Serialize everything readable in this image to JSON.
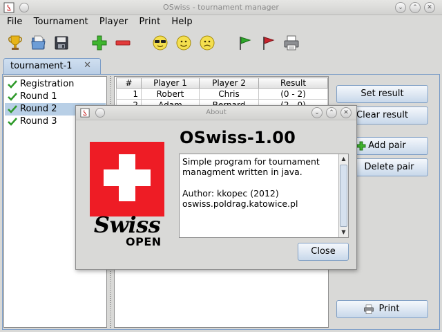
{
  "window": {
    "title": "OSwiss - tournament manager"
  },
  "menu": [
    "File",
    "Tournament",
    "Player",
    "Print",
    "Help"
  ],
  "toolbar_icons": [
    "trophy-icon",
    "open-icon",
    "save-icon",
    "add-icon",
    "remove-icon",
    "cool-smiley-icon",
    "happy-smiley-icon",
    "sad-smiley-icon",
    "green-flag-icon",
    "red-flag-icon",
    "printer-icon"
  ],
  "tab": {
    "label": "tournament-1",
    "close": "✕"
  },
  "tree": [
    {
      "label": "Registration"
    },
    {
      "label": "Round 1"
    },
    {
      "label": "Round 2"
    },
    {
      "label": "Round 3"
    }
  ],
  "table": {
    "headers": [
      "#",
      "Player 1",
      "Player 2",
      "Result"
    ],
    "rows": [
      [
        "1",
        "Robert",
        "Chris",
        "(0 - 2)"
      ],
      [
        "2",
        "Adam",
        "Bernard",
        "(2 - 0)"
      ]
    ]
  },
  "buttons": {
    "set_result": "Set result",
    "clear_result": "Clear result",
    "add_pair": "Add pair",
    "delete_pair": "Delete pair",
    "print": "Print"
  },
  "dialog": {
    "title": "About",
    "version": "OSwiss-1.00",
    "logo_word": "Swiss",
    "logo_sub": "OPEN",
    "text_line1": "Simple program for tournament",
    "text_line2": "managment written in java.",
    "author": "Author: kkopec (2012)",
    "site": "oswiss.poldrag.katowice.pl",
    "close": "Close"
  },
  "colors": {
    "accent": "#7a9cc7",
    "selection": "#b8cfe6",
    "swiss_red": "#ee1c25"
  }
}
